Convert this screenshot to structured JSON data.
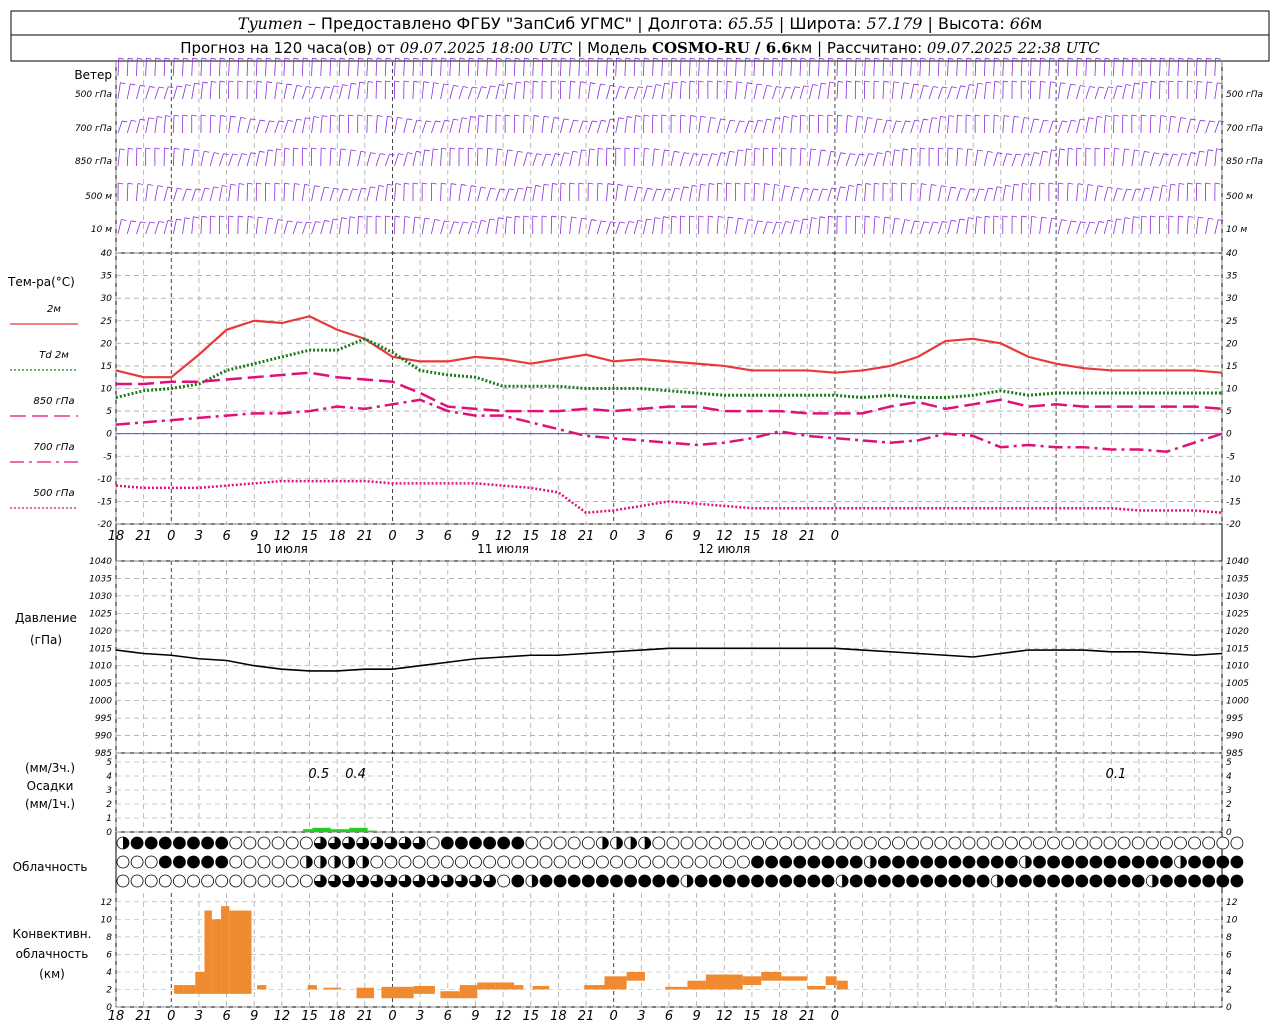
{
  "header": {
    "city": "Tyumen",
    "provider": " – Предоставлено ФГБУ \"ЗапСиб УГМС\" | Долгота: ",
    "lon": "65.55",
    "lat_label": " | Широта: ",
    "lat": "57.179",
    "alt_label": " | Высота: ",
    "alt": "66",
    "alt_unit": "м",
    "forecast_label": "Прогноз на 120 часа(ов) от ",
    "forecast_from": "09.07.2025 18:00 UTC",
    "model_label": "  | Модель ",
    "model": "COSMO-RU / 6.6",
    "model_unit": "км",
    "calc_label": " | Рассчитано: ",
    "calc_time": "09.07.2025 22:38 UTC"
  },
  "wind_panel": {
    "title": "Ветер",
    "levels": [
      "500 гПа",
      "700 гПа",
      "850 гПа",
      "500 м",
      "10  м"
    ]
  },
  "temp_panel": {
    "title": "Тем-ра(°С)",
    "legend": [
      "2м",
      "Td  2м",
      "850 гПа",
      "700 гПа",
      "500 гПа"
    ],
    "legend_colors": [
      "#e83838",
      "#1a7a1a",
      "#e0107a",
      "#e0107a",
      "#e0107a"
    ],
    "y_ticks": [
      "40",
      "35",
      "30",
      "25",
      "20",
      "15",
      "10",
      "5",
      "0",
      "-5",
      "-10",
      "-15",
      "-20"
    ]
  },
  "x_axis": {
    "hour_labels": [
      "18",
      "21",
      "0",
      "3",
      "6",
      "9",
      "12",
      "15",
      "18",
      "21",
      "0",
      "3",
      "6",
      "9",
      "12",
      "15",
      "18",
      "21",
      "0",
      "3",
      "6",
      "9",
      "12",
      "15",
      "18",
      "21",
      "0"
    ],
    "day_labels": [
      "10 июля",
      "11 июля",
      "12 июля"
    ]
  },
  "pressure_panel": {
    "title": "Давление",
    "unit": "(гПа)",
    "y_ticks": [
      "1040",
      "1035",
      "1030",
      "1025",
      "1020",
      "1015",
      "1010",
      "1005",
      "1000",
      "995",
      "990",
      "985"
    ]
  },
  "precip_panel": {
    "unit_3h": "(мм/3ч.)",
    "title": "Осадки",
    "unit_1h": "(мм/1ч.)",
    "y_ticks": [
      "5",
      "4",
      "3",
      "2",
      "1",
      "0"
    ],
    "totals": [
      "0.5",
      "0.4",
      "0.1"
    ]
  },
  "cloud_panel": {
    "title": "Облачность"
  },
  "conv_panel": {
    "title_1": "Конвективн.",
    "title_2": "облачность",
    "unit": "(км)",
    "y_ticks": [
      "12",
      "10",
      "8",
      "6",
      "4",
      "2",
      "0"
    ]
  },
  "chart_data": [
    {
      "type": "barbs",
      "title": "Ветер",
      "levels": [
        "500 гПа",
        "700 гПа",
        "850 гПа",
        "500 м",
        "10 м"
      ],
      "color": "#8b2be2"
    },
    {
      "type": "line",
      "title": "Тем-ра(°С)",
      "x_hours": [
        0,
        3,
        6,
        9,
        12,
        15,
        18,
        21,
        24,
        27,
        30,
        33,
        36,
        39,
        42,
        45,
        48,
        51,
        54,
        57,
        60,
        63,
        66,
        69,
        72,
        75,
        78,
        81,
        84,
        87,
        90,
        93,
        96,
        99,
        102,
        105,
        108,
        111,
        114,
        117,
        120
      ],
      "ylim": [
        -20,
        40
      ],
      "series": [
        {
          "name": "2м",
          "color": "#e83838",
          "style": "solid",
          "width": 2.2,
          "values": [
            14,
            12.5,
            12.5,
            17.5,
            23,
            25,
            24.5,
            26,
            23,
            21,
            17,
            16,
            16,
            17,
            16.5,
            15.5,
            16.5,
            17.5,
            16,
            16.5,
            16,
            15.5,
            15,
            14,
            14,
            14,
            13.5,
            14,
            15,
            17,
            20.5,
            21,
            20,
            17,
            15.5,
            14.5,
            14,
            14,
            14,
            14,
            13.5
          ]
        },
        {
          "name": "Td  2м",
          "color": "#1a7a1a",
          "style": "dotted",
          "width": 3,
          "values": [
            8,
            9.5,
            10,
            11,
            14,
            15.5,
            17,
            18.5,
            18.5,
            21,
            18,
            14,
            13,
            12.5,
            10.5,
            10.5,
            10.5,
            10,
            10,
            10,
            9.5,
            9,
            8.5,
            8.5,
            8.5,
            8.5,
            8.5,
            8,
            8.5,
            8,
            8,
            8.5,
            9.5,
            8.5,
            9,
            9,
            9,
            9,
            9,
            9,
            9
          ]
        },
        {
          "name": "850 гПа",
          "color": "#e0107a",
          "style": "longdash",
          "width": 2.5,
          "values": [
            11,
            11,
            11.5,
            11.5,
            12,
            12.5,
            13,
            13.5,
            12.5,
            12,
            11.5,
            9,
            6,
            5.5,
            5,
            5,
            5,
            5.5,
            5,
            5.5,
            6,
            6,
            5,
            5,
            5,
            4.5,
            4.5,
            4.5,
            6,
            7,
            5.5,
            6.5,
            7.5,
            6,
            6.5,
            6,
            6,
            6,
            6,
            6,
            5.5
          ]
        },
        {
          "name": "700 гПа",
          "color": "#e0107a",
          "style": "dashdot",
          "width": 2.5,
          "values": [
            2,
            2.5,
            3,
            3.5,
            4,
            4.5,
            4.5,
            5,
            6,
            5.5,
            6.5,
            7.5,
            5,
            4,
            4,
            2.5,
            1,
            -0.5,
            -1,
            -1.5,
            -2,
            -2.5,
            -2,
            -1,
            0.5,
            -0.5,
            -1,
            -1.5,
            -2,
            -1.5,
            0,
            -0.5,
            -3,
            -2.5,
            -3,
            -3,
            -3.5,
            -3.5,
            -4,
            -2,
            0
          ]
        },
        {
          "name": "500 гПа",
          "color": "#e0107a",
          "style": "dotted",
          "width": 2.5,
          "values": [
            -11.5,
            -12,
            -12,
            -12,
            -11.5,
            -11,
            -10.5,
            -10.5,
            -10.5,
            -10.5,
            -11,
            -11,
            -11,
            -11,
            -11.5,
            -12,
            -13,
            -17.5,
            -17,
            -16,
            -15,
            -15.5,
            -16,
            -16.5,
            -16.5,
            -16.5,
            -16.5,
            -16.5,
            -16.5,
            -16.5,
            -16.5,
            -16.5,
            -16.5,
            -16.5,
            -16.5,
            -16.5,
            -16.5,
            -17,
            -17,
            -17,
            -17.5
          ]
        }
      ]
    },
    {
      "type": "line",
      "title": "Давление",
      "ylim": [
        985,
        1040
      ],
      "x_hours": [
        0,
        3,
        6,
        9,
        12,
        15,
        18,
        21,
        24,
        27,
        30,
        33,
        36,
        39,
        42,
        45,
        48,
        51,
        54,
        57,
        60,
        63,
        66,
        69,
        72,
        75,
        78,
        81,
        84,
        87,
        90,
        93,
        96,
        99,
        102,
        105,
        108,
        111,
        114,
        117,
        120
      ],
      "series": [
        {
          "name": "",
          "color": "#000000",
          "values": [
            1014.5,
            1013.5,
            1013,
            1012,
            1011.5,
            1010,
            1009,
            1008.5,
            1008.5,
            1009,
            1009,
            1010,
            1011,
            1012,
            1012.5,
            1013,
            1013,
            1013.5,
            1014,
            1014.5,
            1015,
            1015,
            1015,
            1015,
            1015,
            1015,
            1015,
            1014.5,
            1014,
            1013.5,
            1013,
            1012.5,
            1013.5,
            1014.5,
            1014.5,
            1014.5,
            1014,
            1014,
            1013.5,
            1013,
            1013.5
          ]
        }
      ]
    },
    {
      "type": "bar",
      "title": "Осадки",
      "ylim": [
        0,
        5
      ],
      "x_hours": [
        70,
        71,
        72,
        73,
        74,
        75,
        76,
        77,
        108,
        109
      ],
      "values": [
        0.2,
        0.3,
        0.3,
        0.2,
        0.2,
        0.3,
        0.3,
        0.1,
        0.05,
        0.05
      ],
      "color": "#22cc22"
    },
    {
      "type": "bar",
      "title": "Конвективн. облачность",
      "ylim": [
        0,
        13
      ],
      "segments": [
        {
          "x0": 6.3,
          "x1": 7.3,
          "bottom": 1.5,
          "top": 2.5
        },
        {
          "x0": 7.3,
          "x1": 8.6,
          "bottom": 1.5,
          "top": 2.5
        },
        {
          "x0": 8.6,
          "x1": 9.6,
          "bottom": 1.5,
          "top": 4
        },
        {
          "x0": 9.6,
          "x1": 10.4,
          "bottom": 1.5,
          "top": 11
        },
        {
          "x0": 10.4,
          "x1": 11.4,
          "bottom": 1.5,
          "top": 10
        },
        {
          "x0": 11.4,
          "x1": 12.3,
          "bottom": 1.5,
          "top": 11.5
        },
        {
          "x0": 12.3,
          "x1": 14.7,
          "bottom": 1.5,
          "top": 11
        },
        {
          "x0": 15.3,
          "x1": 16.3,
          "bottom": 2,
          "top": 2.5
        },
        {
          "x0": 20.8,
          "x1": 21.8,
          "bottom": 2,
          "top": 2.5
        },
        {
          "x0": 22.5,
          "x1": 24.4,
          "bottom": 2,
          "top": 2.2
        },
        {
          "x0": 26.1,
          "x1": 28,
          "bottom": 1,
          "top": 2.2
        },
        {
          "x0": 28.8,
          "x1": 32.3,
          "bottom": 1,
          "top": 2.3
        },
        {
          "x0": 32.3,
          "x1": 34.6,
          "bottom": 1.5,
          "top": 2.4
        },
        {
          "x0": 35.2,
          "x1": 37.3,
          "bottom": 1,
          "top": 1.8
        },
        {
          "x0": 37.3,
          "x1": 39.2,
          "bottom": 1,
          "top": 2.5
        },
        {
          "x0": 39.2,
          "x1": 41.2,
          "bottom": 2,
          "top": 2.8
        },
        {
          "x0": 41.2,
          "x1": 43.2,
          "bottom": 2,
          "top": 2.8
        },
        {
          "x0": 43.2,
          "x1": 44.2,
          "bottom": 2,
          "top": 2.5
        },
        {
          "x0": 45.2,
          "x1": 47,
          "bottom": 2,
          "top": 2.4
        },
        {
          "x0": 50.8,
          "x1": 53,
          "bottom": 2,
          "top": 2.5
        },
        {
          "x0": 53,
          "x1": 55.4,
          "bottom": 2,
          "top": 3.5
        },
        {
          "x0": 55.4,
          "x1": 57.4,
          "bottom": 3,
          "top": 4
        },
        {
          "x0": 59.6,
          "x1": 62,
          "bottom": 2,
          "top": 2.3
        },
        {
          "x0": 62,
          "x1": 64,
          "bottom": 2,
          "top": 3
        },
        {
          "x0": 64,
          "x1": 68,
          "bottom": 2,
          "top": 3.7
        },
        {
          "x0": 68,
          "x1": 70,
          "bottom": 2.5,
          "top": 3.5
        },
        {
          "x0": 70,
          "x1": 72.2,
          "bottom": 3,
          "top": 4
        },
        {
          "x0": 72.2,
          "x1": 75,
          "bottom": 3,
          "top": 3.5
        },
        {
          "x0": 75,
          "x1": 77,
          "bottom": 2,
          "top": 2.4
        },
        {
          "x0": 77,
          "x1": 78.2,
          "bottom": 2.5,
          "top": 3.5
        },
        {
          "x0": 78.2,
          "x1": 79.4,
          "bottom": 2,
          "top": 3
        }
      ],
      "color": "#f08a30"
    }
  ]
}
